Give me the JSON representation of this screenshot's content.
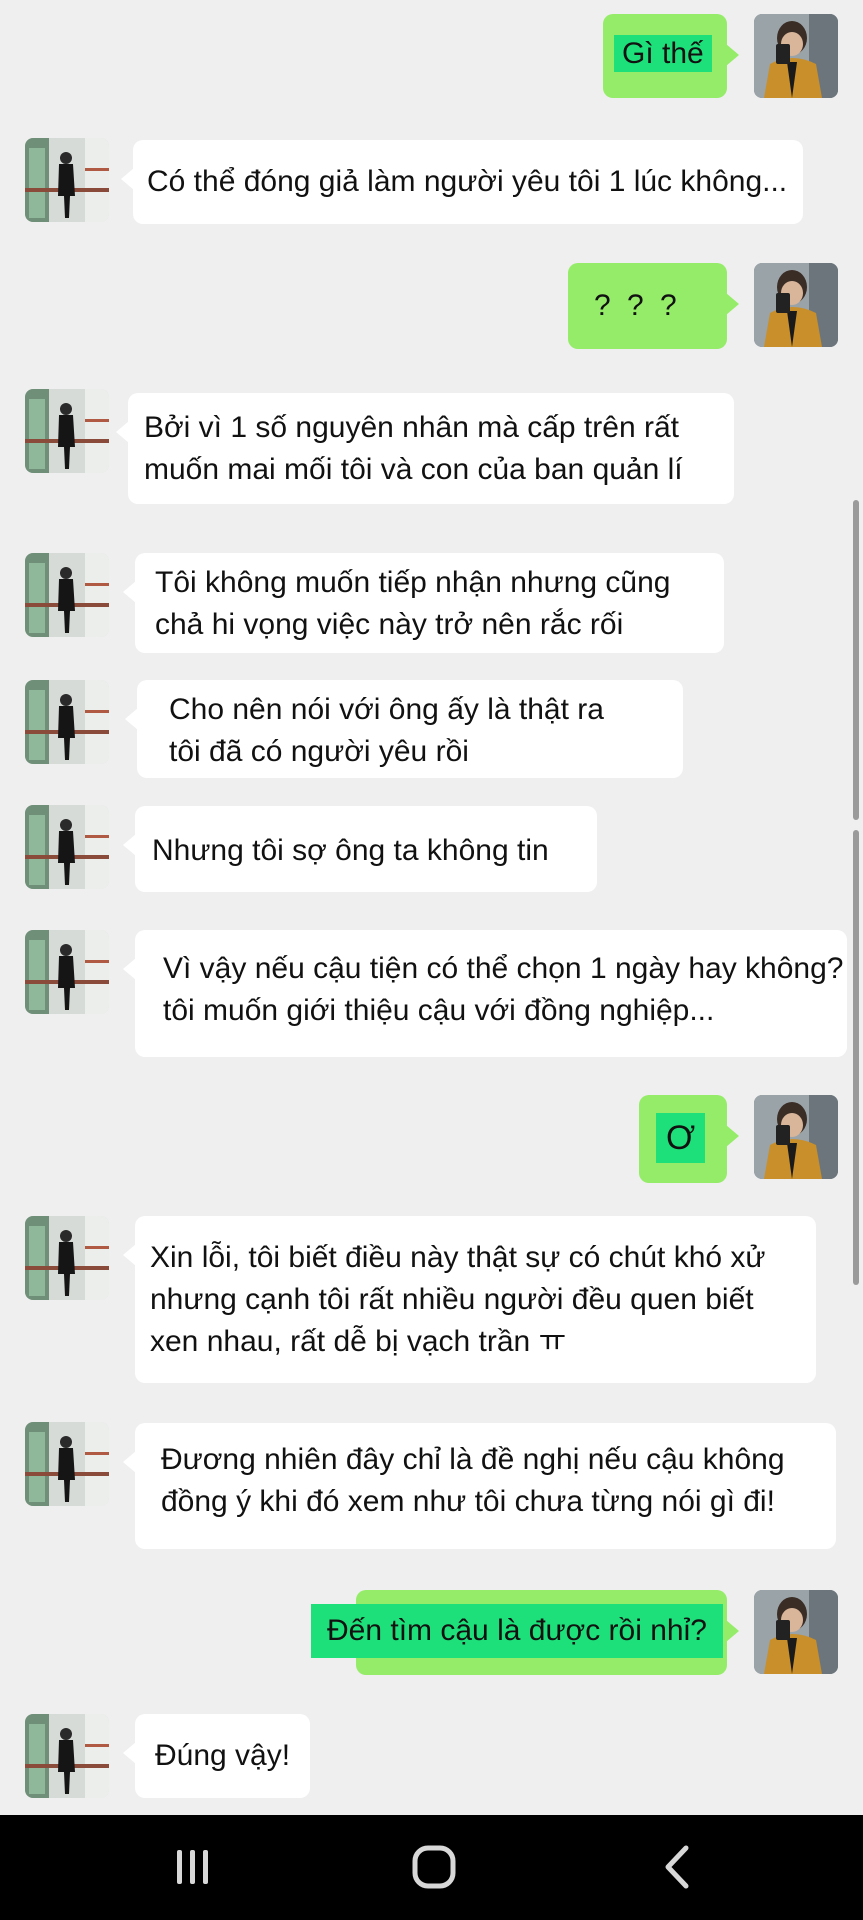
{
  "messages": [
    {
      "side": "out",
      "lines": [
        "Gì thế"
      ]
    },
    {
      "side": "in",
      "lines": [
        "Có thể đóng giả làm người yêu tôi 1 lúc không..."
      ]
    },
    {
      "side": "out",
      "lines": [
        "? ? ?"
      ]
    },
    {
      "side": "in",
      "lines": [
        "Bởi vì 1 số nguyên nhân mà cấp trên rất",
        "muốn mai mối tôi và con của ban quản lí"
      ]
    },
    {
      "side": "in",
      "lines": [
        "Tôi không muốn tiếp nhận nhưng cũng",
        "chả hi vọng việc này trở nên rắc rối"
      ]
    },
    {
      "side": "in",
      "lines": [
        "Cho nên nói với ông ấy là thật ra",
        "tôi đã có người yêu rồi"
      ]
    },
    {
      "side": "in",
      "lines": [
        "Nhưng tôi sợ ông ta không tin"
      ]
    },
    {
      "side": "in",
      "lines": [
        "Vì vậy nếu cậu tiện có thể chọn 1 ngày hay không?",
        " tôi muốn giới thiệu cậu với đồng nghiệp..."
      ]
    },
    {
      "side": "out",
      "lines": [
        "Ơ"
      ]
    },
    {
      "side": "in",
      "lines": [
        "Xin lỗi, tôi biết điều này thật sự có chút khó xử",
        "nhưng cạnh tôi rất nhiều người đều quen biết",
        "xen nhau, rất dễ bị vạch trần ㅠ"
      ]
    },
    {
      "side": "in",
      "lines": [
        "Đương nhiên đây chỉ là đề nghị nếu cậu không",
        "đồng ý khi đó xem như tôi chưa từng nói gì đi!"
      ]
    },
    {
      "side": "out",
      "lines": [
        "Đến tìm cậu là được rồi nhỉ?"
      ]
    },
    {
      "side": "in",
      "lines": [
        "Đúng vậy!"
      ]
    }
  ],
  "avatars": {
    "self": "avatar-self-photo (yellow jacket, mirror selfie)",
    "contact": "avatar-contact-photo (man in dark suit, standing)"
  },
  "navbar": {
    "recents_icon": "recent-apps-icon",
    "home_icon": "home-icon",
    "back_icon": "back-icon"
  },
  "colors": {
    "background": "#efefef",
    "outgoing_bubble": "#95ec69",
    "highlight": "#1ee07a",
    "incoming_bubble": "#ffffff",
    "navbar": "#000000"
  }
}
